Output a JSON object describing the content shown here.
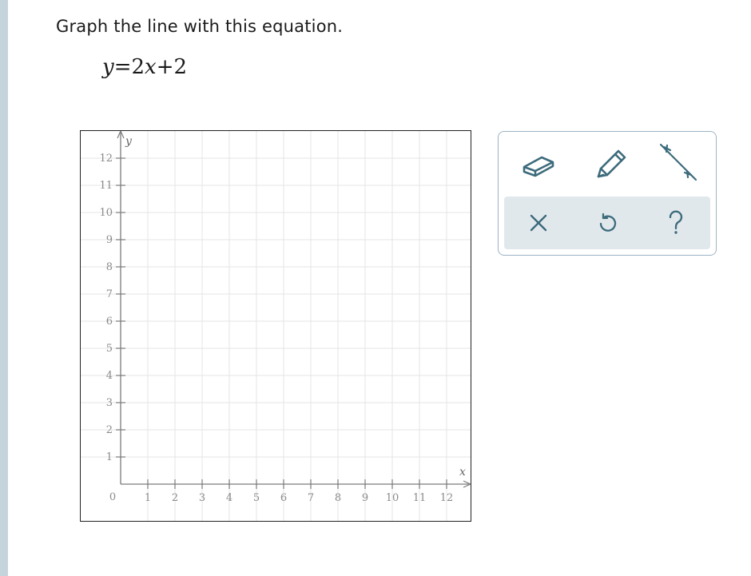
{
  "question": {
    "prompt": "Graph the line with this equation.",
    "equation": {
      "lhs": "y",
      "equals": "=",
      "coef": "2",
      "var": "x",
      "op": "+",
      "const": "2"
    }
  },
  "graph": {
    "x_axis_label": "x",
    "y_axis_label": "y",
    "origin_label": "0",
    "x_ticks": [
      "1",
      "2",
      "3",
      "4",
      "5",
      "6",
      "7",
      "8",
      "9",
      "10",
      "11",
      "12"
    ],
    "y_ticks": [
      "1",
      "2",
      "3",
      "4",
      "5",
      "6",
      "7",
      "8",
      "9",
      "10",
      "11",
      "12"
    ],
    "x_range": [
      0,
      12
    ],
    "y_range": [
      0,
      12
    ],
    "grid": true
  },
  "tools": {
    "items": [
      {
        "name": "eraser-icon"
      },
      {
        "name": "pencil-icon"
      },
      {
        "name": "line-tool-icon"
      }
    ],
    "actions": [
      {
        "name": "clear-icon"
      },
      {
        "name": "undo-icon"
      },
      {
        "name": "help-icon"
      }
    ]
  },
  "colors": {
    "accent": "#3d6b7c",
    "grid": "#e4e4e4",
    "axis": "#7a7a7a",
    "toolbar_border": "#9bb4c6",
    "action_bg": "#e1e8ec",
    "left_bar": "#c5d3dc"
  }
}
